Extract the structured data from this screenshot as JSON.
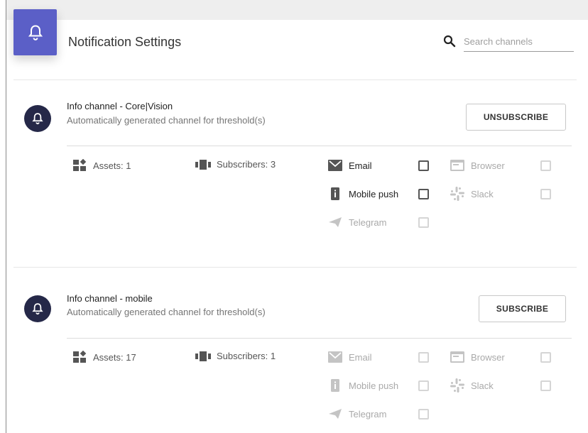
{
  "header": {
    "title": "Notification Settings",
    "search_placeholder": "Search channels",
    "search_value": ""
  },
  "channels": [
    {
      "name": "Info channel - Core|Vision",
      "description": "Automatically generated channel for threshold(s)",
      "action_label": "UNSUBSCRIBE",
      "assets": "Assets: 1",
      "subscribers": "Subscribers: 3",
      "methods": {
        "email": {
          "label": "Email",
          "enabled": true,
          "checked": false
        },
        "mobile_push": {
          "label": "Mobile push",
          "enabled": true,
          "checked": false
        },
        "telegram": {
          "label": "Telegram",
          "enabled": false,
          "checked": false
        },
        "browser": {
          "label": "Browser",
          "enabled": false,
          "checked": false
        },
        "slack": {
          "label": "Slack",
          "enabled": false,
          "checked": false
        }
      }
    },
    {
      "name": "Info channel - mobile",
      "description": "Automatically generated channel for threshold(s)",
      "action_label": "SUBSCRIBE",
      "assets": "Assets: 17",
      "subscribers": "Subscribers: 1",
      "methods": {
        "email": {
          "label": "Email",
          "enabled": false,
          "checked": false
        },
        "mobile_push": {
          "label": "Mobile push",
          "enabled": false,
          "checked": false
        },
        "telegram": {
          "label": "Telegram",
          "enabled": false,
          "checked": false
        },
        "browser": {
          "label": "Browser",
          "enabled": false,
          "checked": false
        },
        "slack": {
          "label": "Slack",
          "enabled": false,
          "checked": false
        }
      }
    }
  ],
  "colors": {
    "accent": "#5b5fc7",
    "avatar": "#252848",
    "active_icon": "#555555",
    "inactive_icon": "#c4c4c4"
  }
}
